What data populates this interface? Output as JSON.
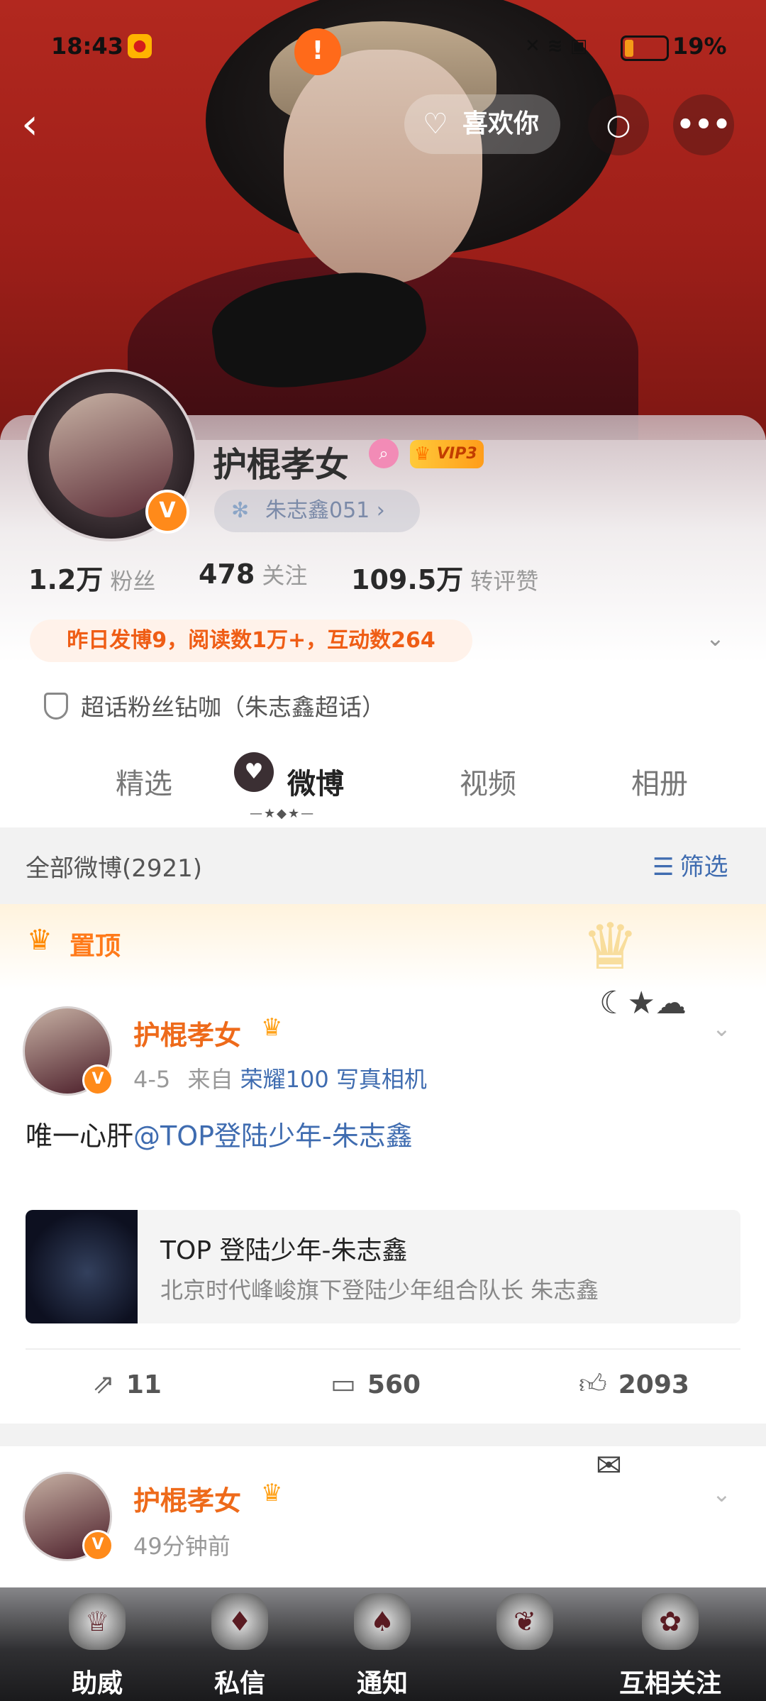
{
  "status_bar": {
    "time": "18:43",
    "battery": "19%",
    "alert_icon": "!"
  },
  "header": {
    "back_icon": "‹",
    "like_button_label": "喜欢你",
    "search_icon": "○",
    "more_icon": "•••"
  },
  "profile": {
    "name": "护棍孝女",
    "vip_label": "VIP3",
    "verified_mark": "V",
    "super_topic_tag": "朱志鑫051 ›",
    "stats": [
      {
        "value": "1.2万",
        "label": "粉丝"
      },
      {
        "value": "478",
        "label": "关注"
      },
      {
        "value": "109.5万",
        "label": "转评赞"
      }
    ],
    "daily_summary": "昨日发博9，阅读数1万+，互动数264",
    "fan_title": "超话粉丝钻咖（朱志鑫超话）"
  },
  "tabs": [
    {
      "label": "精选"
    },
    {
      "label": "微博"
    },
    {
      "label": "视频"
    },
    {
      "label": "相册"
    }
  ],
  "filter": {
    "count_label": "全部微博(2921)",
    "filter_label": "筛选"
  },
  "pinned": {
    "label": "置顶"
  },
  "posts": [
    {
      "author": "护棍孝女",
      "meta_time": "4-5",
      "meta_from": "来自",
      "meta_device": "荣耀100 写真相机",
      "text_prefix": "唯一心肝",
      "mention": "@TOP登陆少年-朱志鑫",
      "link_title": "TOP 登陆少年-朱志鑫",
      "link_subtitle": "北京时代峰峻旗下登陆少年组合队长 朱志鑫",
      "reposts": "11",
      "comments": "560",
      "likes": "2093"
    },
    {
      "author": "护棍孝女",
      "meta_time": "49分钟前"
    }
  ],
  "bottom_nav": [
    {
      "label": "助威"
    },
    {
      "label": "私信"
    },
    {
      "label": "通知"
    },
    {
      "label": ""
    },
    {
      "label": "互相关注"
    }
  ],
  "colors": {
    "accent_orange": "#ee6a1a",
    "link_blue": "#3f6cb0",
    "banner_red": "#b2281f"
  }
}
